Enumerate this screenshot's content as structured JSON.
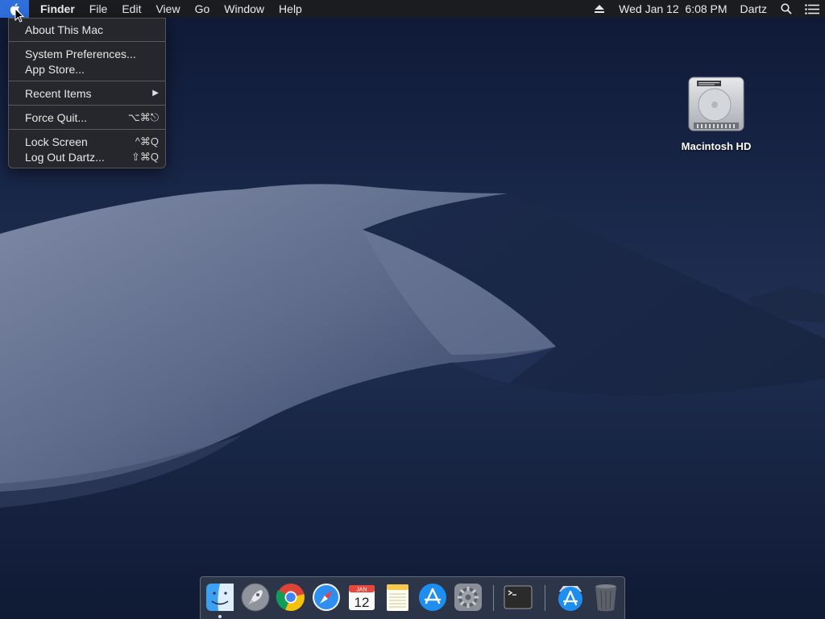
{
  "menubar": {
    "app_name": "Finder",
    "menus": [
      "File",
      "Edit",
      "View",
      "Go",
      "Window",
      "Help"
    ],
    "clock": "Wed Jan 12  6:08 PM",
    "user": "Dartz",
    "icons": [
      "apple-icon",
      "eject-icon",
      "spotlight-search-icon",
      "notification-center-icon"
    ]
  },
  "apple_menu": {
    "about": "About This Mac",
    "system_prefs": "System Preferences...",
    "app_store": "App Store...",
    "recent_items": "Recent Items",
    "force_quit": "Force Quit...",
    "force_quit_shortcut": "⌥⌘⎋",
    "lock_screen": "Lock Screen",
    "lock_screen_shortcut": "^⌘Q",
    "log_out": "Log Out Dartz...",
    "log_out_shortcut": "⇧⌘Q"
  },
  "desktop": {
    "hd_label": "Macintosh HD"
  },
  "dock": {
    "apps": [
      "finder",
      "launchpad",
      "chrome",
      "safari",
      "calendar",
      "notes",
      "app-store",
      "system-preferences",
      "terminal",
      "app-store-download",
      "trash"
    ],
    "calendar_month": "JAN",
    "calendar_day": "12"
  },
  "colors": {
    "menu_highlight": "#2f6fdc",
    "menubar_bg": "#1c1c1e"
  }
}
